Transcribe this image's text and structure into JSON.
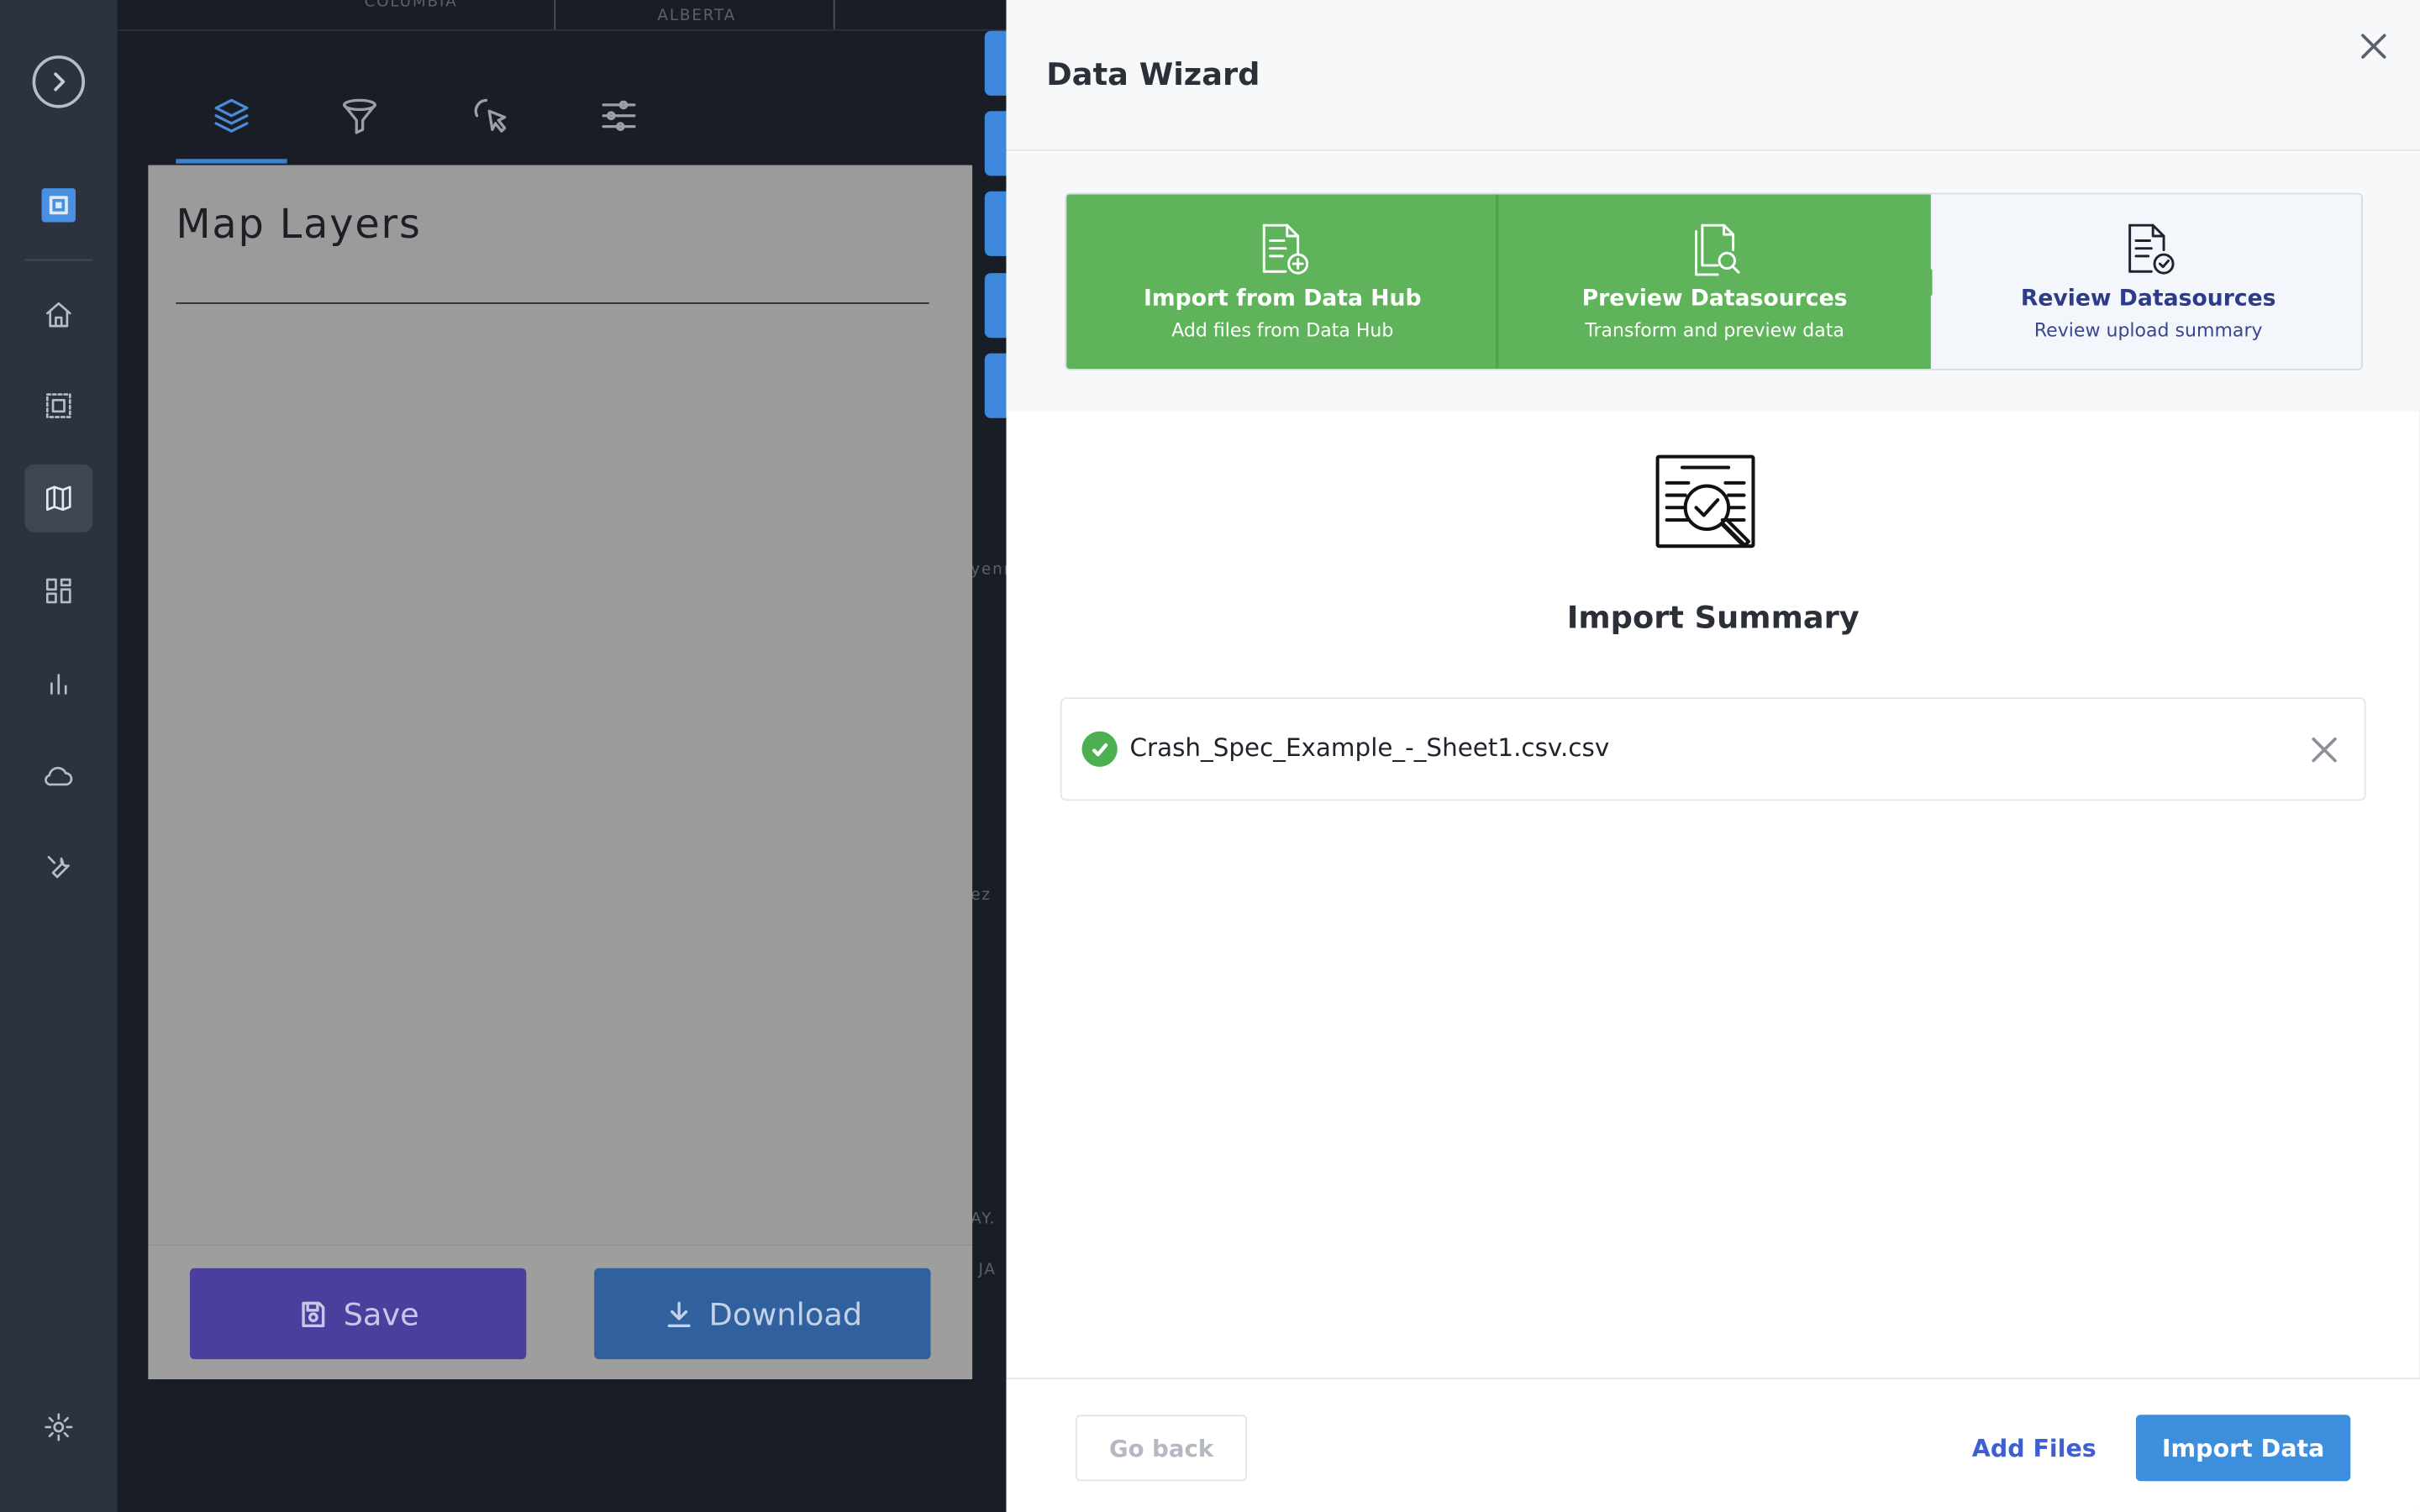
{
  "map": {
    "labels": [
      "COLUMBIA",
      "ALBERTA",
      "yenn",
      "AY.",
      "JA",
      "ez"
    ]
  },
  "nav": {
    "items": [
      {
        "name": "home",
        "icon": "home-icon"
      },
      {
        "name": "selection",
        "icon": "selection-icon"
      },
      {
        "name": "map",
        "icon": "map-icon",
        "active": true
      },
      {
        "name": "dashboard",
        "icon": "dashboard-icon"
      },
      {
        "name": "charts",
        "icon": "bar-chart-icon"
      },
      {
        "name": "cloud",
        "icon": "cloud-icon"
      },
      {
        "name": "tools",
        "icon": "wrench-icon"
      },
      {
        "name": "settings",
        "icon": "gear-icon"
      }
    ]
  },
  "layers_panel": {
    "title": "Map Layers",
    "tabs": [
      "layers-icon",
      "filter-icon",
      "pointer-icon",
      "sliders-icon"
    ],
    "save_label": "Save",
    "download_label": "Download"
  },
  "wizard": {
    "title": "Data Wizard",
    "steps": [
      {
        "title": "Import from Data Hub",
        "subtitle": "Add files from Data Hub",
        "state": "done"
      },
      {
        "title": "Preview Datasources",
        "subtitle": "Transform and preview data",
        "state": "done"
      },
      {
        "title": "Review Datasources",
        "subtitle": "Review upload summary",
        "state": "current"
      }
    ],
    "summary_title": "Import Summary",
    "files": [
      {
        "name": "Crash_Spec_Example_-_Sheet1.csv.csv",
        "status": "success"
      }
    ],
    "go_back_label": "Go back",
    "add_files_label": "Add Files",
    "import_label": "Import Data",
    "colors": {
      "step_done": "#5fb35a",
      "primary": "#3e8ede",
      "link": "#3f5ed1"
    }
  }
}
